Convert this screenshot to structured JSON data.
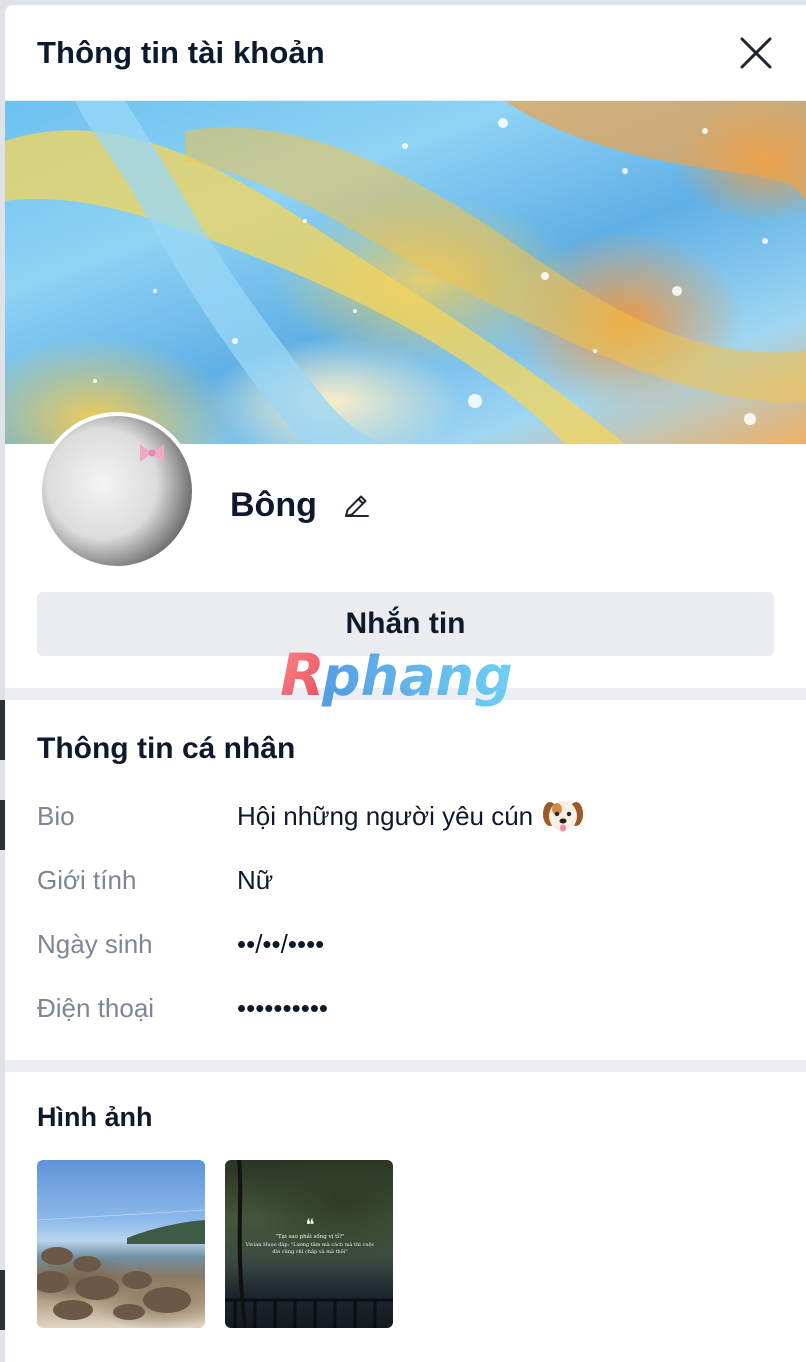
{
  "modal": {
    "title": "Thông tin tài khoản",
    "close_icon": "close-icon"
  },
  "profile": {
    "name": "Bông",
    "edit_icon": "pencil-icon",
    "message_label": "Nhắn tin"
  },
  "watermark": {
    "text": "Rphang"
  },
  "personal_info": {
    "title": "Thông tin cá nhân",
    "rows": [
      {
        "label": "Bio",
        "value": "Hội những người yêu cún",
        "icon": "dog-face-emoji"
      },
      {
        "label": "Giới tính",
        "value": "Nữ"
      },
      {
        "label": "Ngày sinh",
        "value": "••/••/••••"
      },
      {
        "label": "Điện thoại",
        "value": "••••••••••"
      }
    ]
  },
  "images": {
    "title": "Hình ảnh",
    "items": [
      {
        "name": "beach-photo"
      },
      {
        "name": "lake-quote-photo",
        "quote_mark": "❝",
        "quote_line1": "\"Tại sao phải sống vị tỉ?\"",
        "quote_line2": "Vivian Huọo đáp: \"Lương tâm mà cách mà thì cuộc đời củng chỉ chấp và mà thôi\""
      }
    ]
  },
  "colors": {
    "title_text": "#0e1a2b",
    "label_text": "#7b8798",
    "button_bg": "#eaecf0",
    "divider": "#eceef1"
  }
}
